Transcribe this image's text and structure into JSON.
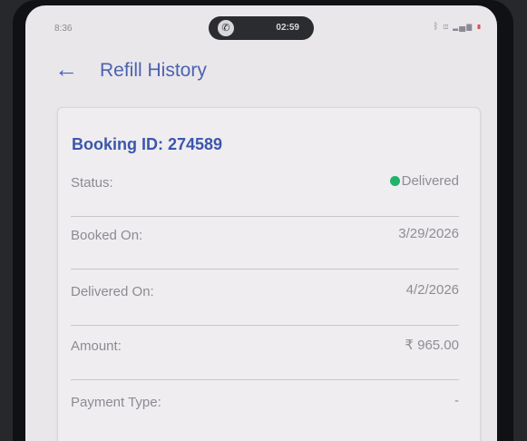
{
  "statusbar": {
    "time": "8:36",
    "call_timer": "02:59",
    "icons": [
      "bluetooth-icon",
      "nfc-icon",
      "signal-icon",
      "battery-icon"
    ]
  },
  "appbar": {
    "title": "Refill History",
    "back_icon": "arrow-left-icon"
  },
  "booking": {
    "id_label": "Booking ID: 274589",
    "rows": [
      {
        "label": "Status:",
        "value": "Delivered",
        "status_color": "#21b36a"
      },
      {
        "label": "Booked On:",
        "value": "3/29/2026"
      },
      {
        "label": "Delivered On:",
        "value": "4/2/2026"
      },
      {
        "label": "Amount:",
        "value": "₹ 965.00"
      },
      {
        "label": "Payment Type:",
        "value": "-"
      }
    ]
  },
  "colors": {
    "accent": "#4b62b0",
    "status_delivered": "#21b36a"
  }
}
